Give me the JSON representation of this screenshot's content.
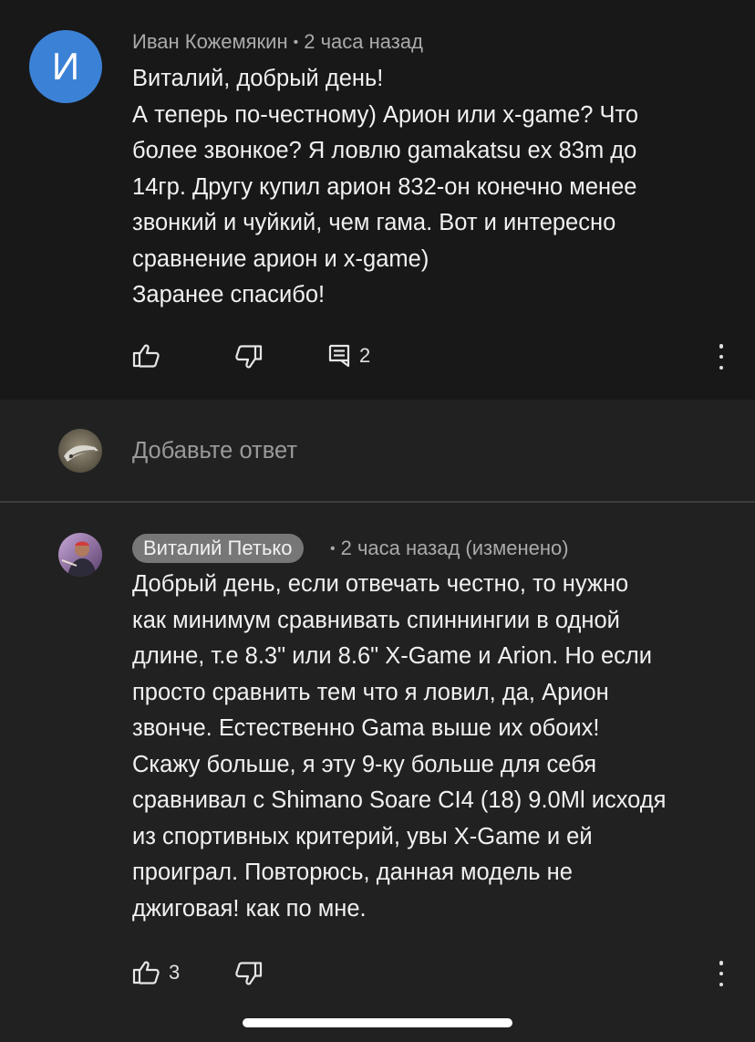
{
  "colors": {
    "background": "#212121",
    "top_comment_background": "#181818",
    "avatar_blue": "#3b82d6",
    "meta_text": "#aaaaaa",
    "primary_text": "#f1f1f1",
    "author_chip": "#777777"
  },
  "top_comment": {
    "avatar_letter": "И",
    "author": "Иван Кожемякин",
    "separator": "•",
    "time": "2 часа назад",
    "lines": [
      "Виталий, добрый день!",
      "А теперь по-честному) Арион или x-game? Что",
      "более звонкое? Я ловлю gamakatsu ex 83m до",
      "14гр. Другу купил арион 832-он конечно менее",
      "звонкий и чуйкий, чем гама. Вот и интересно",
      "сравнение  арион и x-game)",
      "Заранее спасибо!"
    ],
    "actions": {
      "like_icon": "thumb-up-icon",
      "dislike_icon": "thumb-down-icon",
      "replies_icon": "comment-icon",
      "replies_count": "2",
      "more_icon": "more-vertical-icon"
    }
  },
  "reply_composer": {
    "avatar": "user-avatar-photo",
    "placeholder": "Добавьте ответ"
  },
  "reply": {
    "avatar": "author-avatar-photo",
    "author": "Виталий Петько",
    "separator": "•",
    "time": "2 часа назад (изменено)",
    "lines": [
      "Добрый день, если отвечать честно, то нужно",
      "как минимум сравнивать спиннингии в одной",
      "длине, т.е 8.3\" или 8.6\" X-Game и Arion. Но если",
      "просто сравнить тем что я ловил, да, Арион",
      "звонче. Естественно Gama выше их обоих!",
      "Скажу больше, я эту 9-ку больше для себя",
      "сравнивал с Shimano Soare CI4 (18) 9.0Ml исходя",
      "из спортивных критерий, увы X-Game  и ей",
      "проиграл. Повторюсь, данная модель не",
      "джиговая! как по мне."
    ],
    "actions": {
      "like_icon": "thumb-up-icon",
      "like_count": "3",
      "dislike_icon": "thumb-down-icon",
      "more_icon": "more-vertical-icon"
    }
  }
}
